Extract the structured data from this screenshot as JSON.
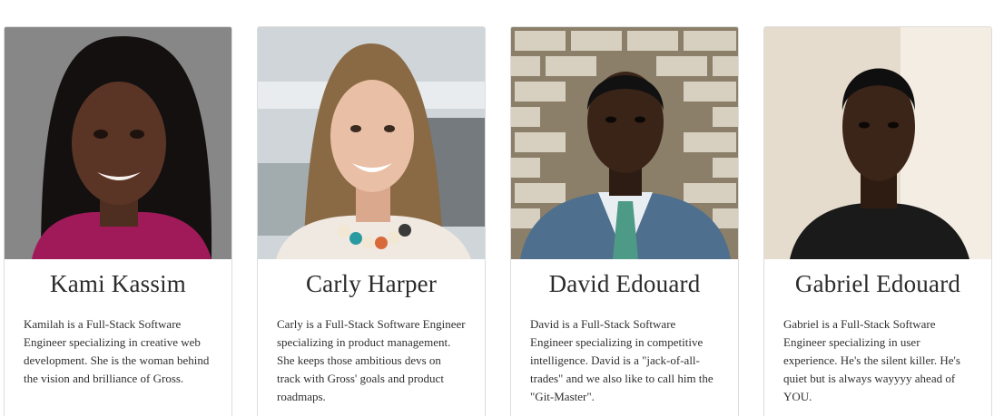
{
  "team": [
    {
      "name": "Kami Kassim",
      "bio": "Kamilah is a Full-Stack Software Engineer specializing in creative web development. She is the woman behind the vision and brilliance of Gross.",
      "photo": {
        "background": "#8a8a8a",
        "skin": "#5a3526",
        "hair": "#141010",
        "clothing": "#a01a5a"
      }
    },
    {
      "name": "Carly Harper",
      "bio": "Carly is a Full-Stack Software Engineer specializing in product management. She keeps those ambitious devs on track with Gross' goals and product roadmaps.",
      "photo": {
        "background": "#d8dcde",
        "skin": "#e9bfa5",
        "hair": "#8a6a44",
        "clothing": "#efe9e2"
      }
    },
    {
      "name": "David Edouard",
      "bio": "David is a Full-Stack Software Engineer specializing in competitive intelligence. David is a \"jack-of-all-trades\" and we also like to call him the \"Git-Master\".",
      "photo": {
        "background": "#b9ad95",
        "skin": "#3a2418",
        "hair": "#111111",
        "clothing": "#4f6f8f"
      }
    },
    {
      "name": "Gabriel Edouard",
      "bio": "Gabriel is a Full-Stack Software Engineer specializing in user experience. He's the silent killer. He's quiet but is always wayyyy ahead of YOU.",
      "photo": {
        "background": "#e8e0d4",
        "skin": "#3b2418",
        "hair": "#0f0f0f",
        "clothing": "#1a1a1a"
      }
    }
  ]
}
